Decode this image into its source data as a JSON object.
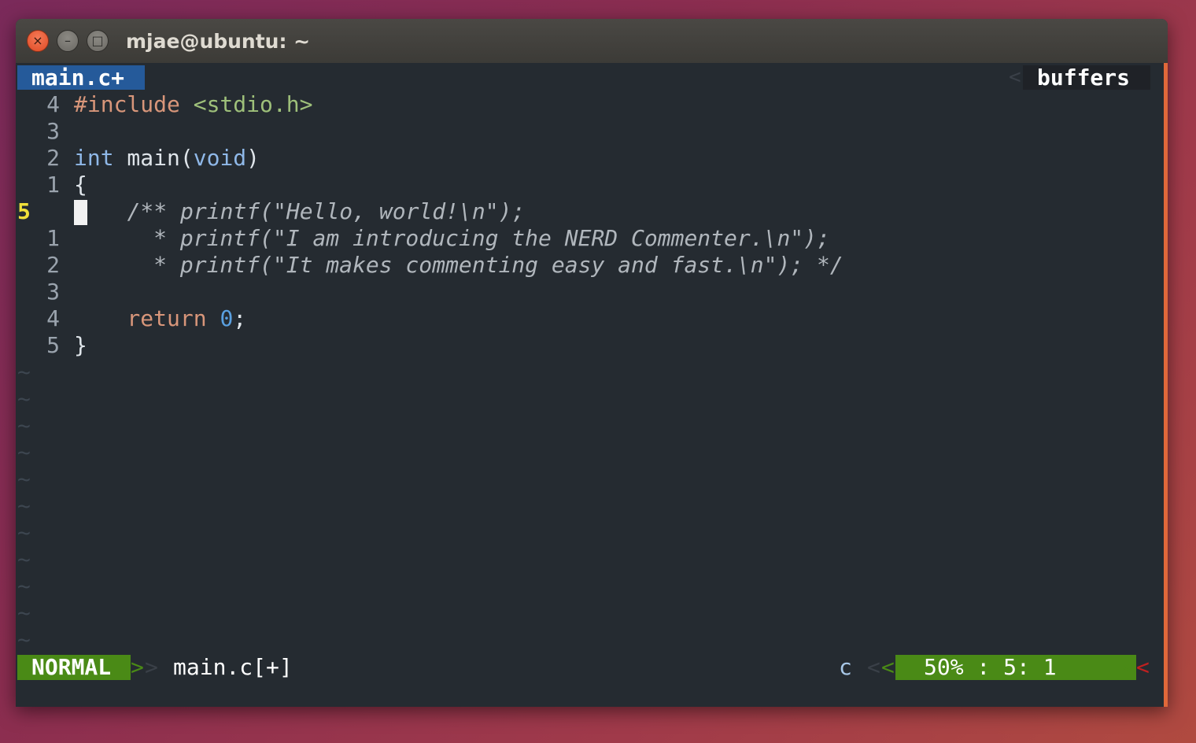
{
  "window": {
    "title": "mjae@ubuntu: ~",
    "close_glyph": "×",
    "min_glyph": "–",
    "max_glyph": "□"
  },
  "tabline": {
    "active_tab": "main.c+",
    "right_sep": "<",
    "right_label": "buffers"
  },
  "code": [
    {
      "num": "4",
      "parts": [
        [
          "kw-pre",
          "#include "
        ],
        [
          "str",
          "<stdio.h>"
        ]
      ]
    },
    {
      "num": "3",
      "parts": []
    },
    {
      "num": "2",
      "parts": [
        [
          "type",
          "int"
        ],
        [
          "txt",
          " main("
        ],
        [
          "type",
          "void"
        ],
        [
          "txt",
          ")"
        ]
      ]
    },
    {
      "num": "1",
      "parts": [
        [
          "txt",
          "{"
        ]
      ]
    },
    {
      "num": "5",
      "current": true,
      "parts": [
        [
          "txt",
          "   "
        ],
        [
          "com",
          "/** printf(\"Hello, world!\\n\");"
        ]
      ]
    },
    {
      "num": "1",
      "parts": [
        [
          "com",
          "      * printf(\"I am introducing the NERD Commenter.\\n\");"
        ]
      ]
    },
    {
      "num": "2",
      "parts": [
        [
          "com",
          "      * printf(\"It makes commenting easy and fast.\\n\"); */"
        ]
      ]
    },
    {
      "num": "3",
      "parts": []
    },
    {
      "num": "4",
      "parts": [
        [
          "kw-pre",
          "    return "
        ],
        [
          "num",
          "0"
        ],
        [
          "txt",
          ";"
        ]
      ]
    },
    {
      "num": "5",
      "parts": [
        [
          "txt",
          "}"
        ]
      ]
    }
  ],
  "tilde_glyph": "~",
  "tilde_count": 11,
  "statusline": {
    "mode": "NORMAL",
    "sep_left": ">",
    "sep_left2": ">",
    "filename": "main.c[+]",
    "filetype": "c",
    "sep_right": "<",
    "sep_right2": "<",
    "position": "50% :   5:  1",
    "sep_end": "<",
    "sep_end2": "<"
  },
  "colors": {
    "mode_bg": "#4a8a16",
    "tab_active_bg": "#255a9a",
    "accent_bar": "#e0683a"
  }
}
